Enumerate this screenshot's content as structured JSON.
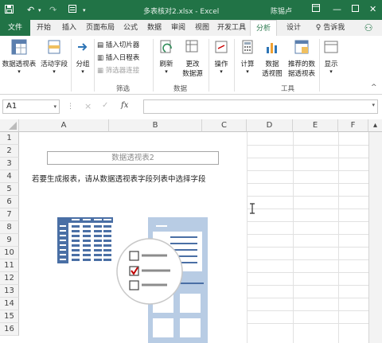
{
  "app": {
    "document_title": "多表核对2.xlsx - Excel",
    "user": "陈锡卢",
    "accent": "#217346"
  },
  "tabs": [
    {
      "label": "文件"
    },
    {
      "label": "开始"
    },
    {
      "label": "插入"
    },
    {
      "label": "页面布局"
    },
    {
      "label": "公式"
    },
    {
      "label": "数据"
    },
    {
      "label": "审阅"
    },
    {
      "label": "视图"
    },
    {
      "label": "开发工具"
    },
    {
      "label": "分析"
    },
    {
      "label": "设计"
    },
    {
      "label": "告诉我"
    }
  ],
  "ribbon": {
    "pivot_table": "数据透视表",
    "active_field": "活动字段",
    "group": "分组",
    "insert_slicer": "插入切片器",
    "insert_timeline": "插入日程表",
    "filter_connections": "筛选器连接",
    "filter_group": "筛选",
    "refresh": "刷新",
    "change_source_1": "更改",
    "change_source_2": "数据源",
    "data_group": "数据",
    "actions": "操作",
    "calculations": "计算",
    "pivot_chart_1": "数据",
    "pivot_chart_2": "透视图",
    "recommended_1": "推荐的数",
    "recommended_2": "据透视表",
    "tools_group": "工具",
    "show": "显示"
  },
  "formula_bar": {
    "name_box": "A1",
    "fx": "fx",
    "cancel": "×",
    "enter": "✓"
  },
  "sheet": {
    "columns": [
      "A",
      "B",
      "C",
      "D",
      "E",
      "F"
    ],
    "rows": [
      "1",
      "2",
      "3",
      "4",
      "5",
      "6",
      "7",
      "8",
      "9",
      "10",
      "11",
      "12",
      "13",
      "14",
      "15",
      "16"
    ],
    "pivot_title": "数据透视表2",
    "pivot_message": "若要生成报表，请从数据透视表字段列表中选择字段"
  }
}
